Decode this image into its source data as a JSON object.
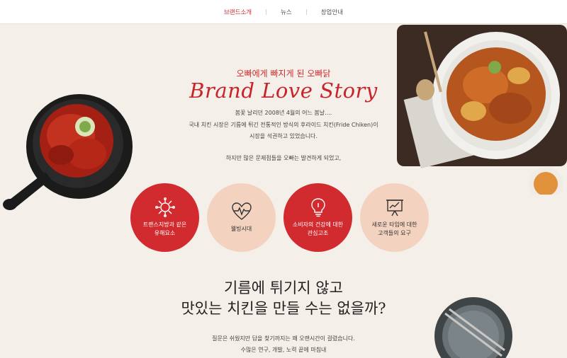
{
  "nav": {
    "items": [
      {
        "label": "브랜드소개",
        "active": true
      },
      {
        "label": "뉴스",
        "active": false
      },
      {
        "label": "창업안내",
        "active": false
      }
    ]
  },
  "hero": {
    "subtitle": "오빠에게 빠지게 된 오빠닭",
    "script_title": "Brand Love Story",
    "paragraph1": [
      "봄꽃 날리던 2008년 4월의 어느 봄날....",
      "국내 치킨 시장은 기름에 튀긴 전통적인 방식의 후라이드 치킨(Fride Chiken)이",
      "시장을 석권하고 있었습니다."
    ],
    "paragraph2": "하지만 많은 문제점들을 오빠는 발견하게 되었고,"
  },
  "circles": [
    {
      "label": "트랜스지방과 같은\n유해요소",
      "icon": "virus-icon",
      "style": "red"
    },
    {
      "label": "웰빙시대",
      "icon": "heartbeat-icon",
      "style": "beige"
    },
    {
      "label": "소비자의 건강에 대한\n관심고조",
      "icon": "lightbulb-icon",
      "style": "red"
    },
    {
      "label": "새로운 타입에 대한\n고객들의 요구",
      "icon": "presentation-board-icon",
      "style": "beige"
    }
  ],
  "question": [
    "기름에 튀기지 않고",
    "맛있는 치킨을 만들 수는 없을까?"
  ],
  "bottom_text": [
    "질문은 쉬웠지만 답을 찾기까지는 꽤 오랜시간이 걸렸습니다.",
    "수많은 연구, 개발, 노력 끝에 마침내"
  ],
  "colors": {
    "accent": "#d12a2f",
    "beige_circle": "#f3d3c0",
    "background": "#f4efe8"
  }
}
